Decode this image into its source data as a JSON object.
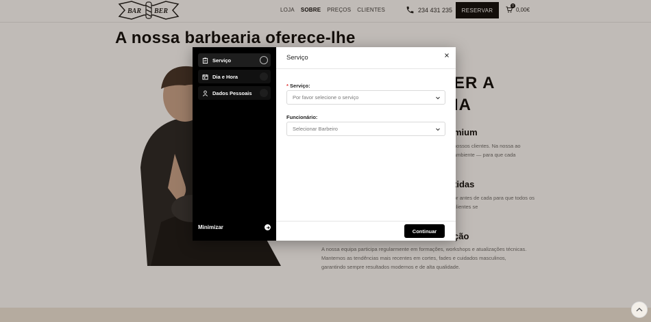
{
  "colors": {
    "accent": "#000000",
    "required": "#dd3333",
    "overlay": "#3c2d1e"
  },
  "header": {
    "logo_text": "BAR BER",
    "nav": [
      "LOJA",
      "SOBRE",
      "PREÇOS",
      "CLIENTES"
    ],
    "active_nav": "SOBRE",
    "phone": "234 431 235",
    "reserve_label": "RESERVAR",
    "cart_count": "0",
    "cart_total": "0,00€"
  },
  "hero": {
    "title": "A nossa barbearia oferece-lhe"
  },
  "right_column": {
    "heading_big_1": "ER A",
    "heading_big_2": "IA",
    "heading_1": "mium",
    "text_1": "nossos clientes. Na nossa ao ambiente — para que cada",
    "heading_2": "tidas",
    "text_2": "or antes de cada para que todos os clientes se",
    "heading_3": "ção",
    "paragraph": "A nossa equipa participa regularmente em formações, workshops e atualizações técnicas. Mantemos as tendências mais recentes em cortes, fades e cuidados masculinos, garantindo sempre resultados modernos e de alta qualidade."
  },
  "modal": {
    "steps": [
      {
        "label": "Serviço",
        "icon": "clipboard-icon",
        "active": true
      },
      {
        "label": "Dia e Hora",
        "icon": "calendar-icon",
        "active": false
      },
      {
        "label": "Dados Pessoais",
        "icon": "user-icon",
        "active": false
      }
    ],
    "minimize_label": "Minimizar",
    "title": "Serviço",
    "service_label": "Serviço:",
    "service_required": "*",
    "service_placeholder": "Por favor selecione o serviço",
    "employee_label": "Funcionário:",
    "employee_placeholder": "Selecionar Barbeiro",
    "continue_label": "Continuar"
  }
}
